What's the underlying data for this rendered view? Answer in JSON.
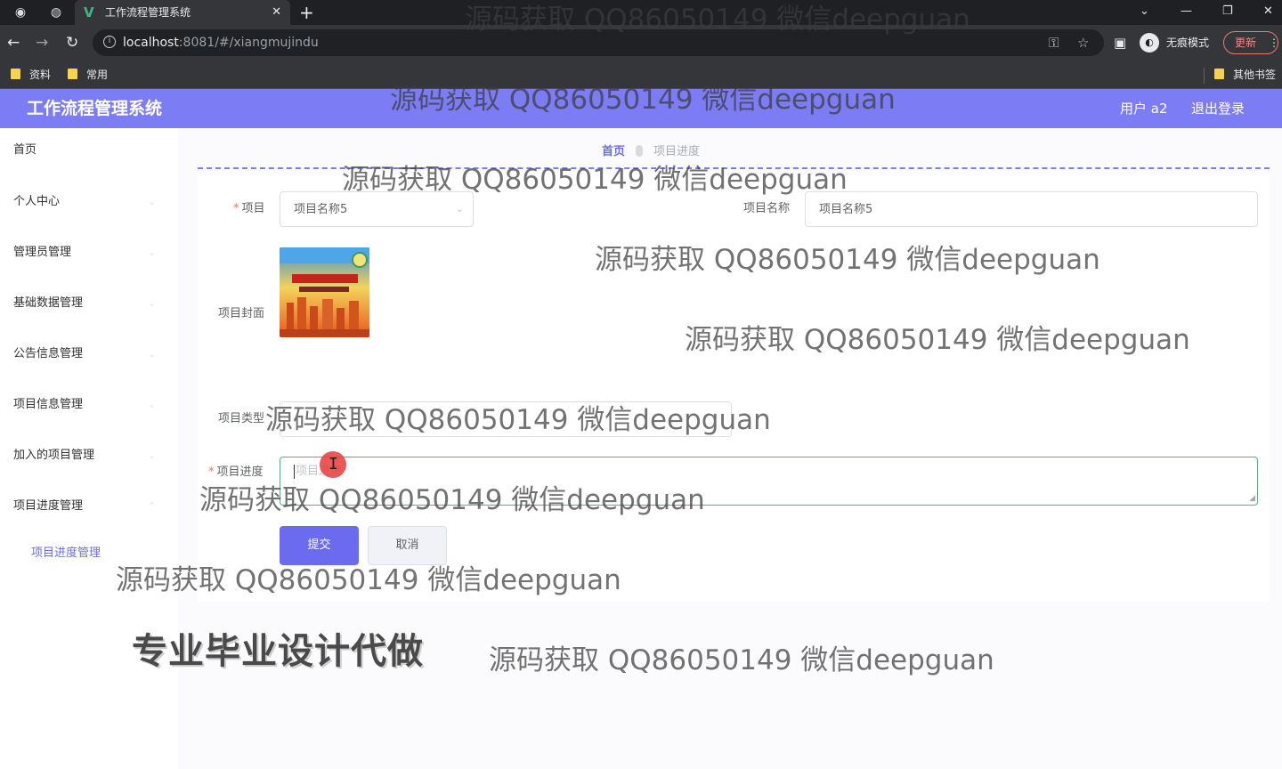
{
  "browser": {
    "tab_title": "工作流程管理系统",
    "tab_favicon": "V",
    "new_tab": "+",
    "url_host": "localhost",
    "url_rest": ":8081/#/xiangmujindu",
    "incognito_label": "无痕模式",
    "update_label": "更新",
    "bookmarks": [
      "资料",
      "常用"
    ],
    "other_bookmarks": "其他书签"
  },
  "header": {
    "title": "工作流程管理系统",
    "user": "用户 a2",
    "logout": "退出登录"
  },
  "sidebar": {
    "items": [
      "首页",
      "个人中心",
      "管理员管理",
      "基础数据管理",
      "公告信息管理",
      "项目信息管理",
      "加入的项目管理",
      "项目进度管理"
    ],
    "sub_item": "项目进度管理"
  },
  "breadcrumb": {
    "home": "首页",
    "current": "项目进度"
  },
  "form": {
    "project_label": "项目",
    "project_value": "项目名称5",
    "project_name_label": "项目名称",
    "project_name_value": "项目名称5",
    "cover_label": "项目封面",
    "type_label": "项目类型",
    "progress_label": "项目进度",
    "progress_placeholder": "项目进度",
    "submit": "提交",
    "cancel": "取消"
  },
  "overlay": {
    "watermark": "源码获取 QQ86050149 微信deepguan",
    "promo": "专业毕业设计代做"
  },
  "colors": {
    "accent": "#7c7cf4",
    "primary_button": "#6b6bef",
    "focus_border": "#42b983",
    "required": "#f56c6c"
  }
}
